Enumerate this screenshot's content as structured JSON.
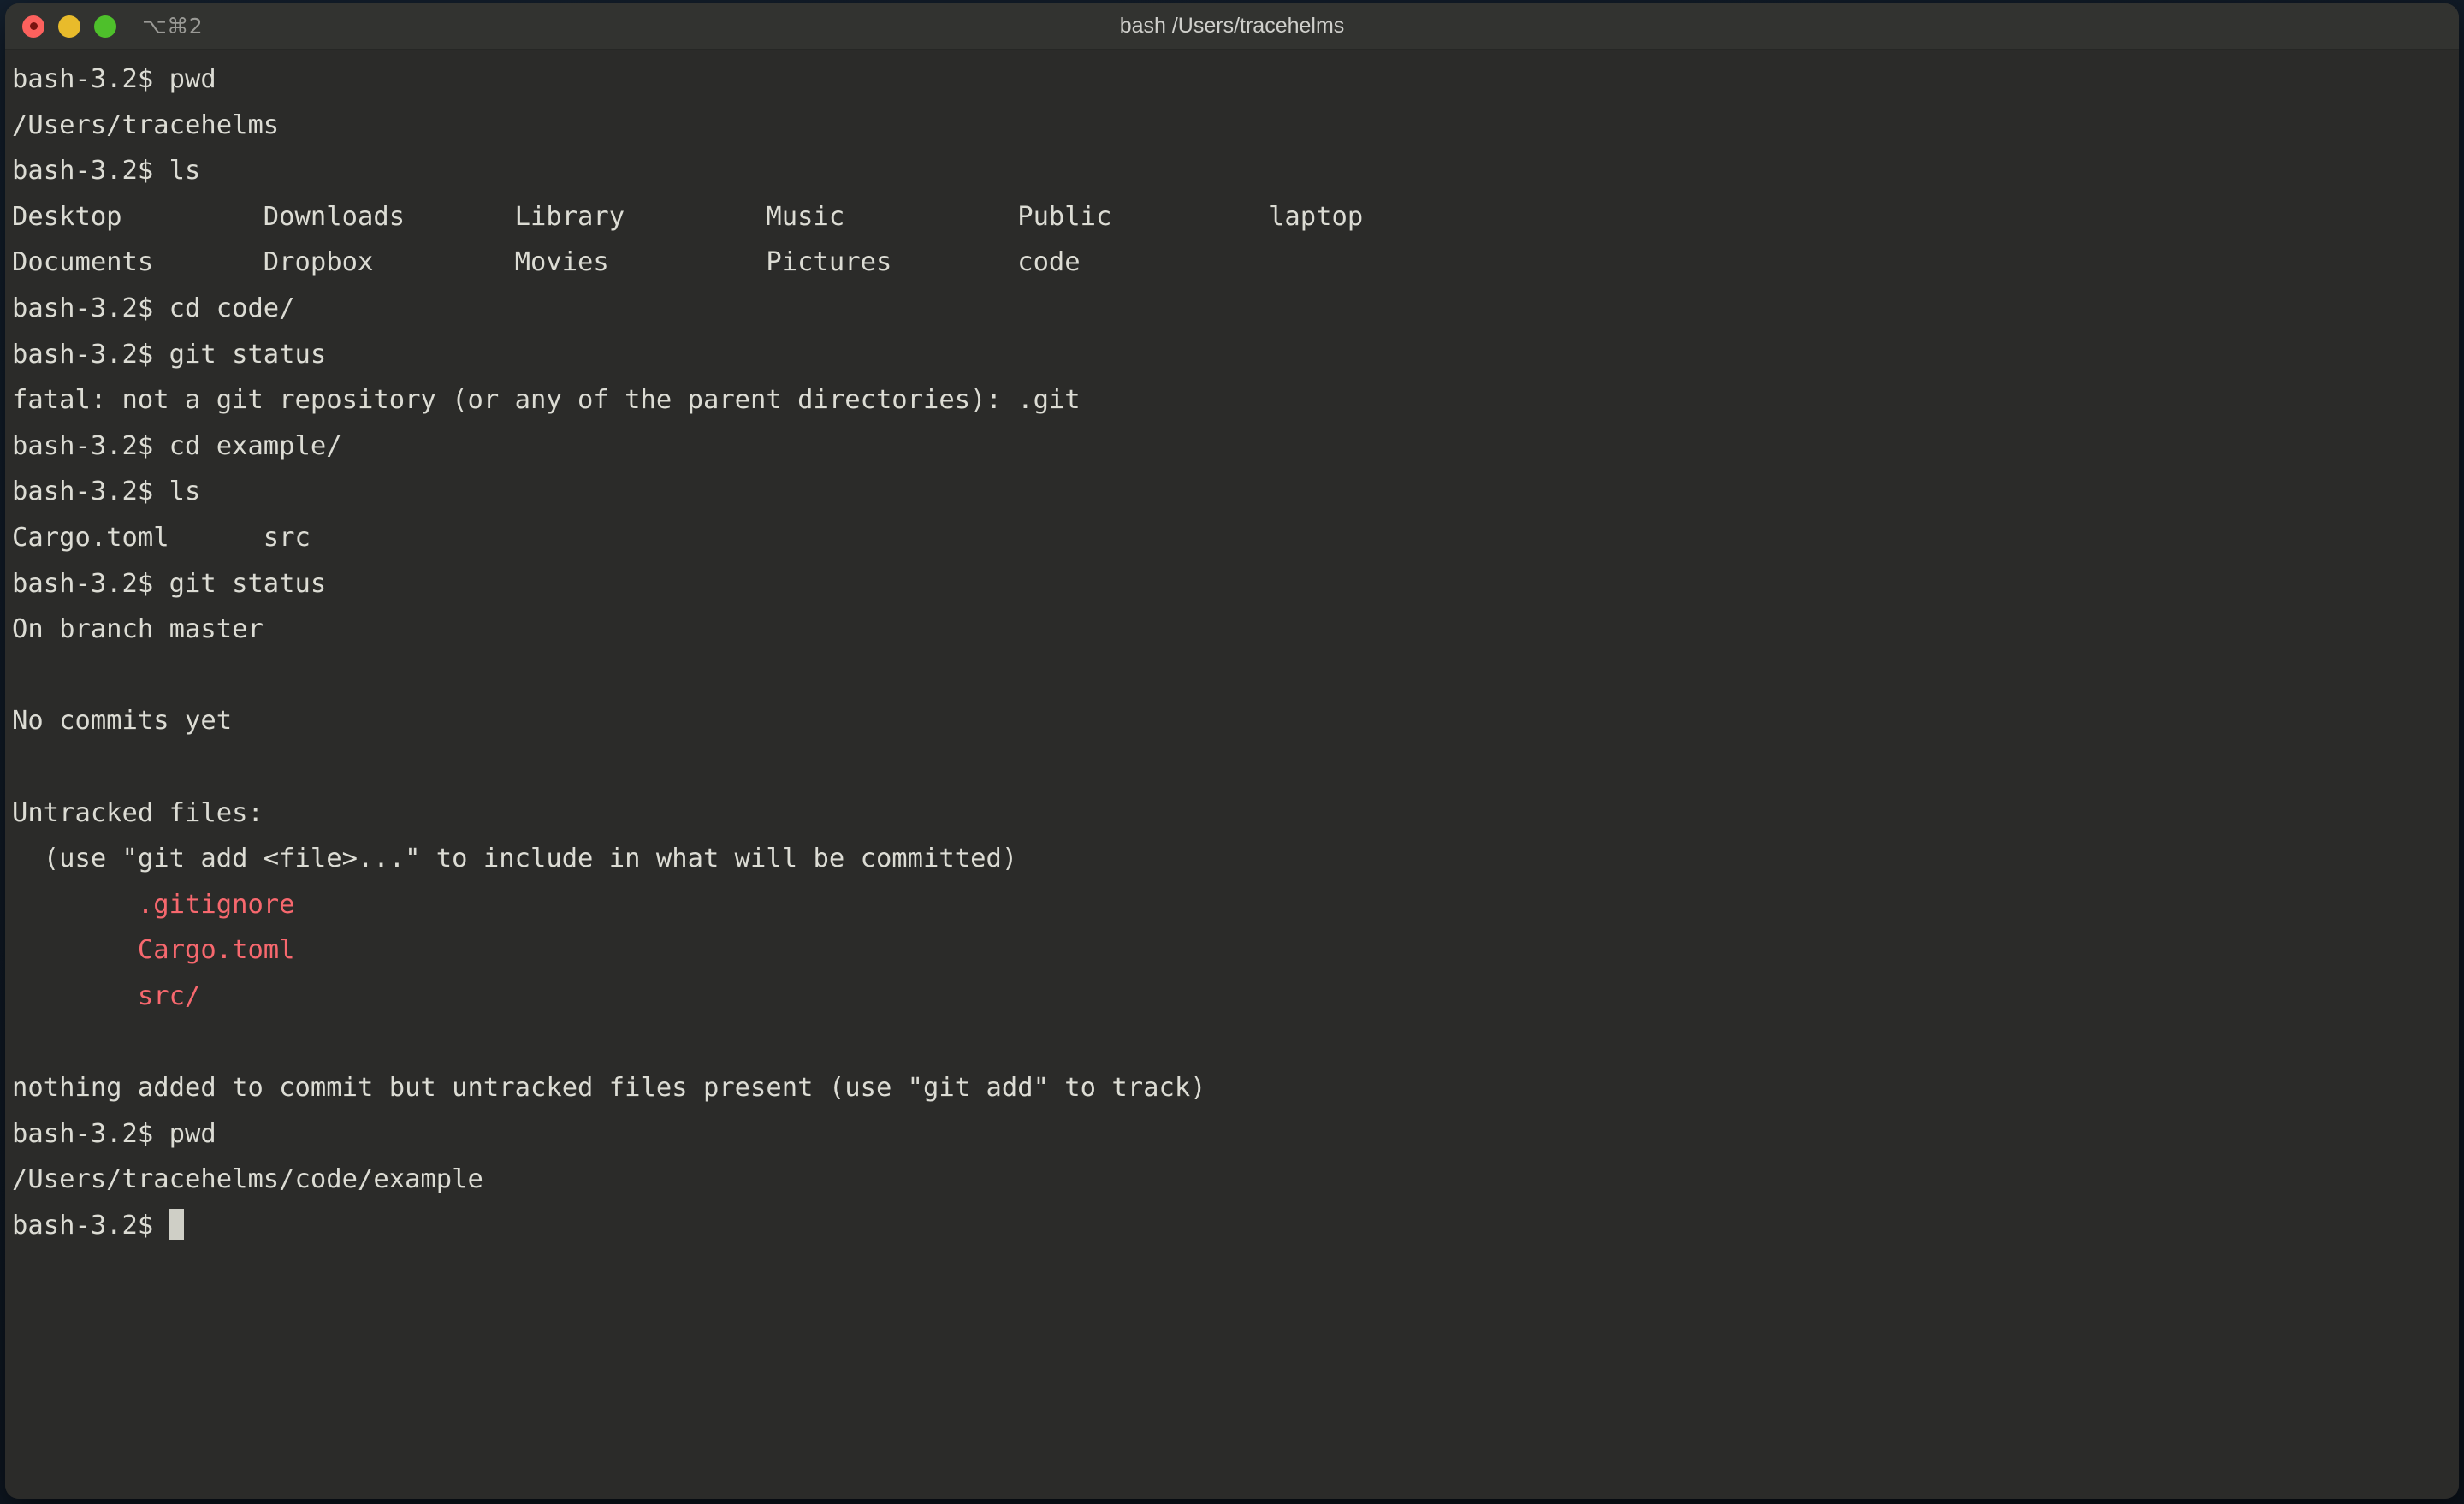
{
  "window": {
    "title": "bash /Users/tracehelms",
    "shortcut": "⌥⌘2",
    "traffic_lights": [
      {
        "name": "close",
        "color": "#fc615d"
      },
      {
        "name": "minimize",
        "color": "#e8bb2b"
      },
      {
        "name": "maximize",
        "color": "#4ec02b"
      }
    ],
    "colors": {
      "titlebar_bg": "#323330",
      "body_bg": "#2b2b29",
      "text": "#dcdcd4",
      "untracked_red": "#f7686e",
      "cursor": "#cfcfc6"
    }
  },
  "terminal": {
    "prompt": "bash-3.2$",
    "cursor": "block",
    "lines": [
      {
        "type": "prompt",
        "text": "bash-3.2$ pwd"
      },
      {
        "type": "output",
        "text": "/Users/tracehelms"
      },
      {
        "type": "prompt",
        "text": "bash-3.2$ ls"
      },
      {
        "type": "output",
        "text": "Desktop         Downloads       Library         Music           Public          laptop"
      },
      {
        "type": "output",
        "text": "Documents       Dropbox         Movies          Pictures        code"
      },
      {
        "type": "prompt",
        "text": "bash-3.2$ cd code/"
      },
      {
        "type": "prompt",
        "text": "bash-3.2$ git status"
      },
      {
        "type": "output",
        "text": "fatal: not a git repository (or any of the parent directories): .git"
      },
      {
        "type": "prompt",
        "text": "bash-3.2$ cd example/"
      },
      {
        "type": "prompt",
        "text": "bash-3.2$ ls"
      },
      {
        "type": "output",
        "text": "Cargo.toml      src"
      },
      {
        "type": "prompt",
        "text": "bash-3.2$ git status"
      },
      {
        "type": "output",
        "text": "On branch master"
      },
      {
        "type": "blank",
        "text": ""
      },
      {
        "type": "output",
        "text": "No commits yet"
      },
      {
        "type": "blank",
        "text": ""
      },
      {
        "type": "output",
        "text": "Untracked files:"
      },
      {
        "type": "output",
        "text": "  (use \"git add <file>...\" to include in what will be committed)"
      },
      {
        "type": "untracked",
        "text": "        .gitignore"
      },
      {
        "type": "untracked",
        "text": "        Cargo.toml"
      },
      {
        "type": "untracked",
        "text": "        src/"
      },
      {
        "type": "blank",
        "text": ""
      },
      {
        "type": "output",
        "text": "nothing added to commit but untracked files present (use \"git add\" to track)"
      },
      {
        "type": "prompt",
        "text": "bash-3.2$ pwd"
      },
      {
        "type": "output",
        "text": "/Users/tracehelms/code/example"
      }
    ],
    "final_prompt": "bash-3.2$ ",
    "ls_home": {
      "columns": [
        "Desktop",
        "Downloads",
        "Library",
        "Music",
        "Public",
        "laptop",
        "Documents",
        "Dropbox",
        "Movies",
        "Pictures",
        "code"
      ]
    },
    "ls_example": {
      "columns": [
        "Cargo.toml",
        "src"
      ]
    },
    "git_status": {
      "branch": "master",
      "commits_state": "No commits yet",
      "untracked_header": "Untracked files:",
      "untracked_hint": "(use \"git add <file>...\" to include in what will be committed)",
      "untracked_files": [
        ".gitignore",
        "Cargo.toml",
        "src/"
      ],
      "summary": "nothing added to commit but untracked files present (use \"git add\" to track)"
    }
  }
}
